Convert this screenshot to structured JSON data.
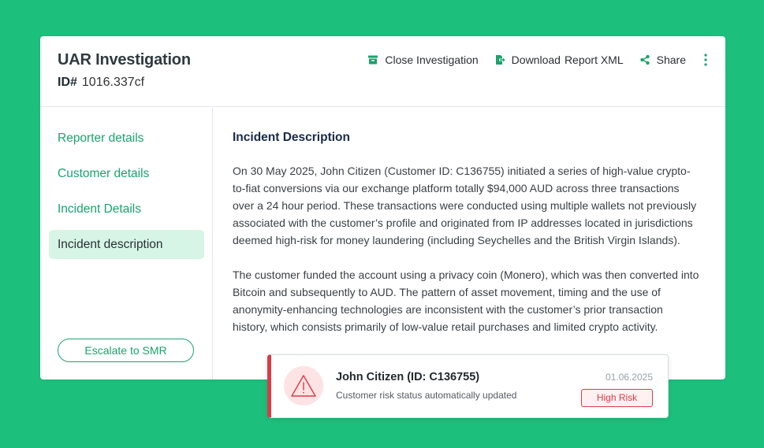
{
  "header": {
    "title": "UAR Investigation",
    "id_label": "ID#",
    "id_value": "1016.337cf"
  },
  "actions": {
    "close_label": "Close Investigation",
    "download_label": "Download",
    "report_label": "Report XML",
    "share_label": "Share"
  },
  "sidebar": {
    "items": [
      {
        "label": "Reporter details"
      },
      {
        "label": "Customer details"
      },
      {
        "label": "Incident Details"
      },
      {
        "label": "Incident description"
      }
    ],
    "escalate_label": "Escalate to SMR"
  },
  "content": {
    "section_title": "Incident Description",
    "paragraphs": [
      "On 30 May 2025, John Citizen (Customer ID: C136755) initiated a series of high-value crypto-to-fiat conversions via our exchange platform totally $94,000 AUD across three transactions over a 24 hour period. These transactions were conducted using multiple wallets not previously associated with the customer’s profile and originated from IP addresses located in jurisdictions deemed high-risk for money laundering (including Seychelles and the British Virgin Islands).",
      "The customer funded the account using a privacy coin (Monero), which was then converted into Bitcoin and subsequently to AUD. The pattern of asset movement, timing and the use of anonymity-enhancing technologies are inconsistent with the customer’s prior transaction history, which consists primarily of low-value retail purchases and limited crypto activity."
    ]
  },
  "toast": {
    "title": "John Citizen (ID: C136755)",
    "subtitle": "Customer risk status automatically updated",
    "date": "01.06.2025",
    "badge": "High Risk"
  },
  "colors": {
    "background": "#1dbf7c",
    "accent": "#1aa36c",
    "active_nav_bg": "#d6f5e7",
    "danger": "#d93c45"
  },
  "icons": [
    "archive-icon",
    "export-icon",
    "share-icon",
    "more-vertical-icon",
    "warning-icon"
  ]
}
